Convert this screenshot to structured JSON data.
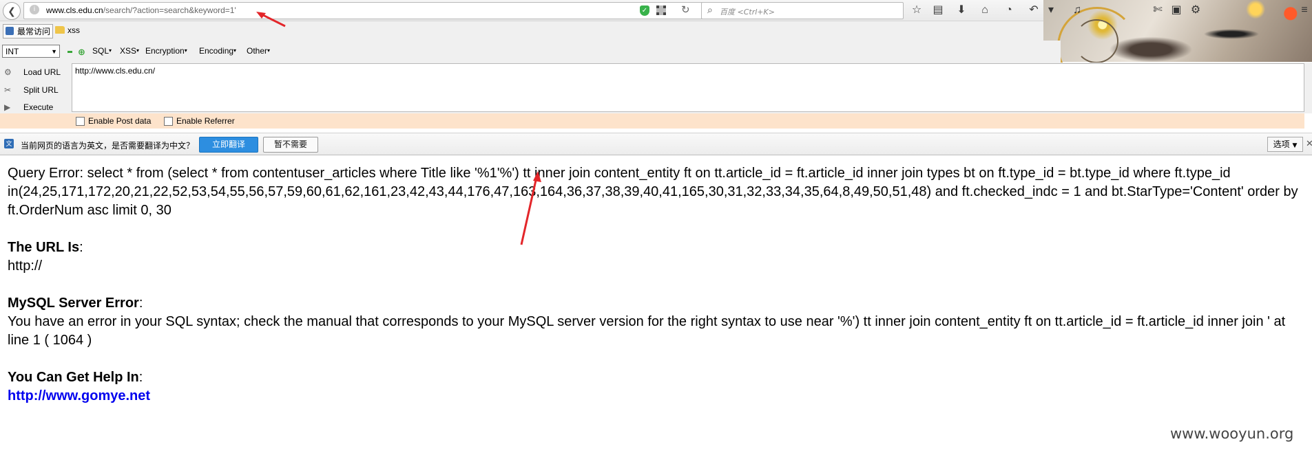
{
  "browser": {
    "url_host": "www.cls.edu.cn",
    "url_path": "/search/?action=search&keyword=1'",
    "search_placeholder": "百度 <Ctrl+K>"
  },
  "bookmarks": [
    {
      "label": "最常访问"
    },
    {
      "label": "xss"
    }
  ],
  "hackbar": {
    "type_select": "INT",
    "menus": [
      "SQL",
      "XSS",
      "Encryption",
      "Encoding",
      "Other"
    ],
    "commands": [
      "Load URL",
      "Split URL",
      "Execute"
    ],
    "url_value": "http://www.cls.edu.cn/",
    "enable_post": "Enable Post data",
    "enable_referrer": "Enable Referrer"
  },
  "translate_bar": {
    "message": "当前网页的语言为英文，是否需要翻译为中文？",
    "translate_button": "立即翻译",
    "decline_button": "暂不需要",
    "options_button": "选项"
  },
  "page": {
    "query_error": "Query Error: select * from (select * from contentuser_articles where Title like '%1'%') tt inner join content_entity ft on tt.article_id = ft.article_id inner join types bt on ft.type_id = bt.type_id where ft.type_id in(24,25,171,172,20,21,22,52,53,54,55,56,57,59,60,61,62,161,23,42,43,44,176,47,163,164,36,37,38,39,40,41,165,30,31,32,33,34,35,64,8,49,50,51,48) and ft.checked_indc = 1 and bt.StarType='Content' order by ft.OrderNum asc limit 0, 30",
    "url_heading": "The URL Is",
    "url_value": "http://",
    "mysql_heading": "MySQL Server Error",
    "mysql_message": "You have an error in your SQL syntax; check the manual that corresponds to your MySQL server version for the right syntax to use near '%') tt inner join content_entity ft on tt.article_id = ft.article_id inner join ' at line 1 ( 1064 )",
    "help_heading": "You Can Get Help In",
    "help_link": "http://www.gomye.net",
    "colon": ":"
  },
  "watermark": "www.wooyun.org",
  "colors": {
    "annotation_arrow": "#e3262a",
    "link": "#0000ee",
    "hackbar_options_bg": "#fde3cb",
    "translate_button_bg": "#2d8ee0"
  }
}
